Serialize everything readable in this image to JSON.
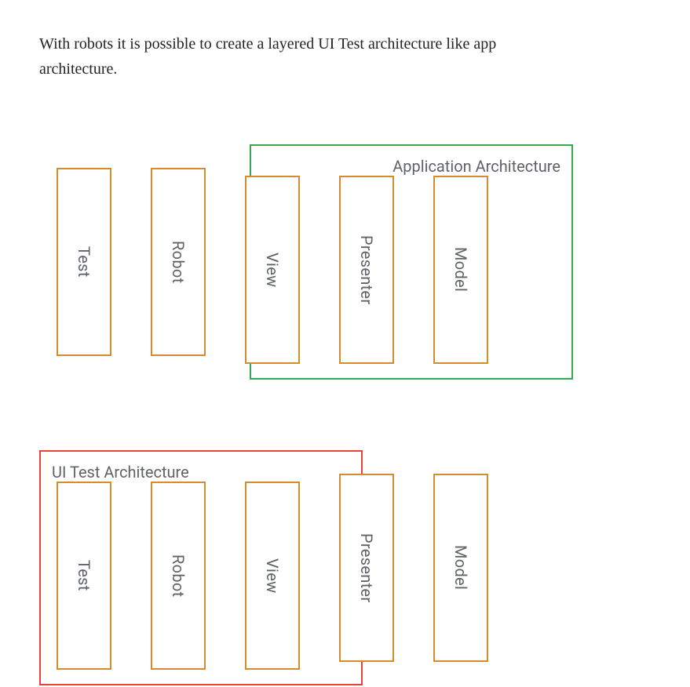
{
  "intro": "With robots it is possible to create a layered UI Test architecture like app architecture.",
  "diagram": {
    "rows": [
      {
        "group": {
          "label": "Application Architecture",
          "color": "green",
          "covers": [
            "View",
            "Presenter",
            "Model"
          ]
        },
        "layers": [
          "Test",
          "Robot",
          "View",
          "Presenter",
          "Model"
        ]
      },
      {
        "group": {
          "label": "UI Test Architecture",
          "color": "red",
          "covers": [
            "Test",
            "Robot",
            "View"
          ]
        },
        "layers": [
          "Test",
          "Robot",
          "View",
          "Presenter",
          "Model"
        ]
      }
    ]
  },
  "colors": {
    "layerBorder": "#d68b2c",
    "greenFrame": "#34a853",
    "redFrame": "#ea4335",
    "text": "#5f6368"
  }
}
